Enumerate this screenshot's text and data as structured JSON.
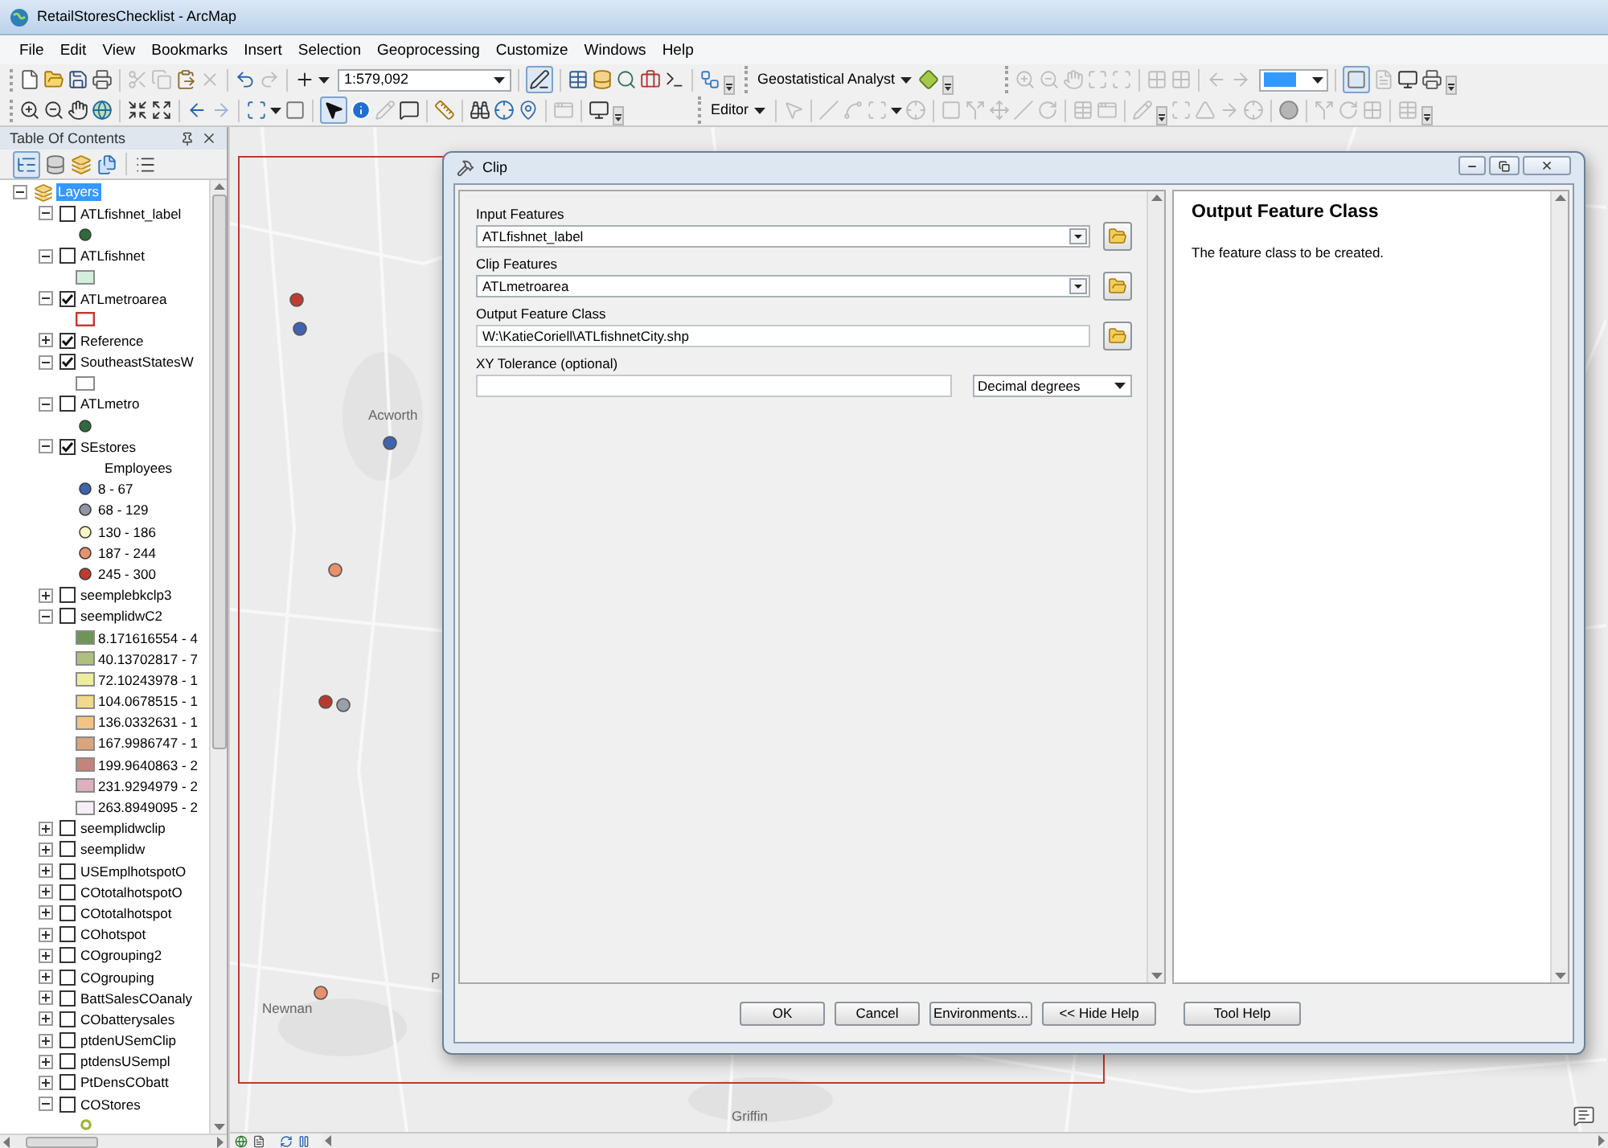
{
  "window": {
    "title": "RetailStoresChecklist - ArcMap"
  },
  "menu_bar": [
    "File",
    "Edit",
    "View",
    "Bookmarks",
    "Insert",
    "Selection",
    "Geoprocessing",
    "Customize",
    "Windows",
    "Help"
  ],
  "toolbars": {
    "scale": "1:579,092",
    "geostatistical_menu": "Geostatistical Analyst",
    "editor_menu": "Editor"
  },
  "table_of_contents": {
    "title": "Table Of Contents",
    "view_buttons": [
      {
        "selected": true
      },
      {
        "selected": false
      },
      {
        "selected": false
      },
      {
        "selected": false
      }
    ],
    "layers": {
      "label": "Layers",
      "selected": true,
      "expanded": true,
      "children": [
        {
          "label": "ATLfishnet_label",
          "checked": false,
          "expanded": true,
          "legend": [
            {
              "kind": "point",
              "color": "#2e6b3a"
            }
          ]
        },
        {
          "label": "ATLfishnet",
          "checked": false,
          "expanded": true,
          "legend": [
            {
              "kind": "fill",
              "color": "#d4eedb"
            }
          ]
        },
        {
          "label": "ATLmetroarea",
          "checked": true,
          "expanded": true,
          "legend": [
            {
              "kind": "outline",
              "color": "#c0392b"
            }
          ]
        },
        {
          "label": "Reference",
          "checked": true,
          "expanded": false
        },
        {
          "label": "SoutheastStatesW",
          "checked": true,
          "expanded": true,
          "legend": [
            {
              "kind": "empty"
            }
          ]
        },
        {
          "label": "ATLmetro",
          "checked": false,
          "expanded": true,
          "legend": [
            {
              "kind": "point",
              "color": "#2e6b3a"
            }
          ]
        },
        {
          "label": "SEstores",
          "checked": true,
          "expanded": true,
          "legend": [
            {
              "kind": "heading",
              "label": "Employees"
            },
            {
              "kind": "point",
              "label": "8 - 67",
              "color": "#3e64b0"
            },
            {
              "kind": "point",
              "label": "68 - 129",
              "color": "#8f97a6"
            },
            {
              "kind": "point",
              "label": "130 - 186",
              "color": "#faf6c2"
            },
            {
              "kind": "point",
              "label": "187 - 244",
              "color": "#e8916a"
            },
            {
              "kind": "point",
              "label": "245 - 300",
              "color": "#c23b2f"
            }
          ]
        },
        {
          "label": "seemplebkclp3",
          "checked": false,
          "expanded": false
        },
        {
          "label": "seemplidwC2",
          "checked": false,
          "expanded": true,
          "legend": [
            {
              "kind": "fill",
              "label": "8.171616554 - 4",
              "color": "#6f9457"
            },
            {
              "kind": "fill",
              "label": "40.13702817 - 7",
              "color": "#aec07c"
            },
            {
              "kind": "fill",
              "label": "72.10243978 - 1",
              "color": "#eded9f"
            },
            {
              "kind": "fill",
              "label": "104.0678515 - 1",
              "color": "#f0d98a"
            },
            {
              "kind": "fill",
              "label": "136.0332631 - 1",
              "color": "#f2c484"
            },
            {
              "kind": "fill",
              "label": "167.9986747 - 1",
              "color": "#d9a57d"
            },
            {
              "kind": "fill",
              "label": "199.9640863 - 2",
              "color": "#c2847c"
            },
            {
              "kind": "fill",
              "label": "231.9294979 - 2",
              "color": "#ddb0bd"
            },
            {
              "kind": "fill",
              "label": "263.8949095 - 2",
              "color": "#f6eef6"
            }
          ]
        },
        {
          "label": "seemplidwclip",
          "checked": false,
          "expanded": false
        },
        {
          "label": "seemplidw",
          "checked": false,
          "expanded": false
        },
        {
          "label": "USEmplhotspotO",
          "checked": false,
          "expanded": false
        },
        {
          "label": "COtotalhotspotO",
          "checked": false,
          "expanded": false
        },
        {
          "label": "COtotalhotspot",
          "checked": false,
          "expanded": false
        },
        {
          "label": "COhotspot",
          "checked": false,
          "expanded": false
        },
        {
          "label": "COgrouping2",
          "checked": false,
          "expanded": false
        },
        {
          "label": "COgrouping",
          "checked": false,
          "expanded": false
        },
        {
          "label": "BattSalesCOanaly",
          "checked": false,
          "expanded": false
        },
        {
          "label": "CObatterysales",
          "checked": false,
          "expanded": false
        },
        {
          "label": "ptdenUSemClip",
          "checked": false,
          "expanded": false
        },
        {
          "label": "ptdensUSempl",
          "checked": false,
          "expanded": false
        },
        {
          "label": "PtDensCObatt",
          "checked": false,
          "expanded": false
        },
        {
          "label": "COStores",
          "checked": false,
          "expanded": true,
          "legend": [
            {
              "kind": "ring",
              "color": "#9bb53a"
            }
          ]
        }
      ]
    }
  },
  "map": {
    "labels": [
      "Acworth",
      "P",
      "Newnan",
      "Griffin"
    ],
    "points": [
      {
        "color": "#c23b2f"
      },
      {
        "color": "#3e64b0"
      },
      {
        "color": "#3e64b0"
      },
      {
        "color": "#e8916a"
      },
      {
        "color": "#b83a2e"
      },
      {
        "color": "#9aa0aa"
      },
      {
        "color": "#e8916a"
      }
    ]
  },
  "dialog": {
    "title": "Clip",
    "parameters": [
      {
        "label": "Input Features",
        "kind": "dropdown",
        "value": "ATLfishnet_label"
      },
      {
        "label": "Clip Features",
        "kind": "dropdown",
        "value": "ATLmetroarea"
      },
      {
        "label": "Output Feature Class",
        "kind": "text",
        "value": "W:\\KatieCoriell\\ATLfishnetCity.shp"
      },
      {
        "label": "XY Tolerance (optional)",
        "kind": "number_with_unit",
        "unit": "Decimal degrees"
      }
    ],
    "help": {
      "title": "Output Feature Class",
      "text": "The feature class to be created."
    },
    "buttons": [
      "OK",
      "Cancel",
      "Environments...",
      "<< Hide Help",
      "Tool Help"
    ]
  }
}
